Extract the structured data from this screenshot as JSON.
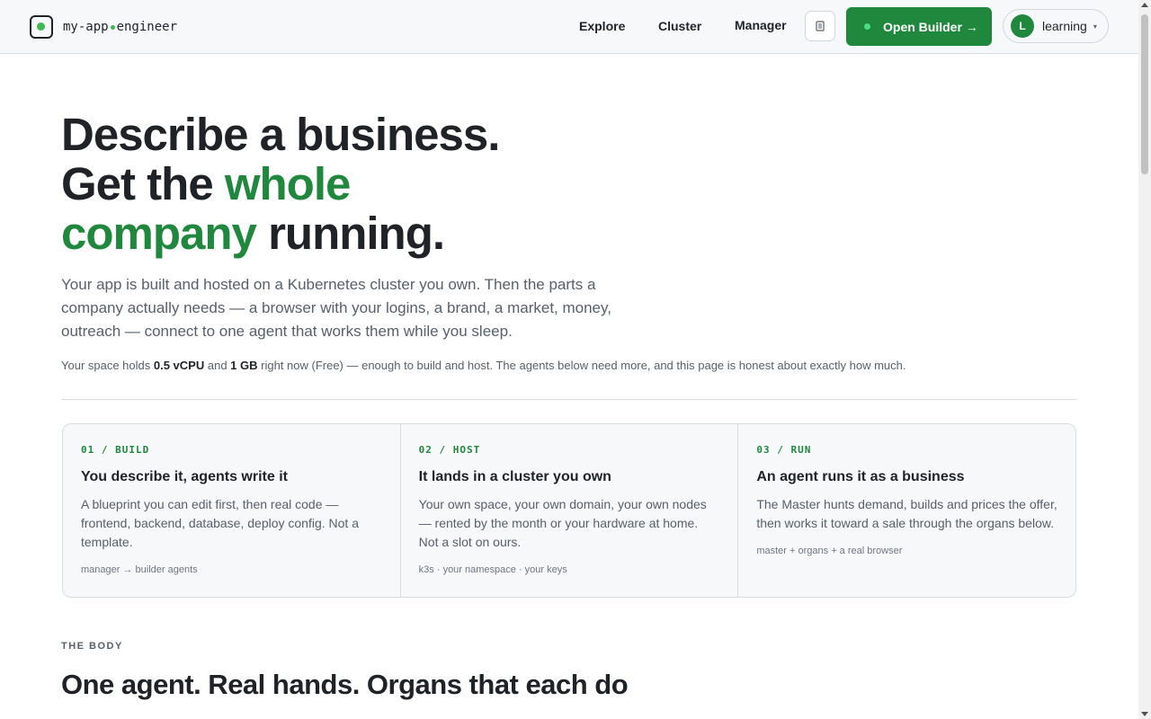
{
  "header": {
    "logo_left": "my-app",
    "logo_right": "engineer",
    "nav": [
      "Explore",
      "Cluster",
      "Manager"
    ],
    "icon_button": "doc-icon",
    "open_builder": "Open Builder →",
    "user": {
      "initial": "L",
      "name": "learning",
      "caret": "▾"
    }
  },
  "hero": {
    "line1": "Describe a business.",
    "line2_pre": "Get the ",
    "line2_green": "whole",
    "line3_green": "company",
    "line3_post": " running."
  },
  "lede": "Your app is built and hosted on a Kubernetes cluster you own. Then the parts a company actually needs — a browser with your logins, a brand, a market, money, outreach — connect to one agent that works them while you sleep.",
  "note": {
    "pre": "Your space holds ",
    "cpu": "0.5 vCPU",
    "mid": " and ",
    "mem": "1 GB",
    "post": " right now (Free) — enough to build and host. The agents below need more, and this page is honest about exactly how much."
  },
  "cards": [
    {
      "step": "01 / BUILD",
      "title": "You describe it, agents write it",
      "desc": "A blueprint you can edit first, then real code — frontend, backend, database, deploy config. Not a template.",
      "foot": "manager → builder agents"
    },
    {
      "step": "02 / HOST",
      "title": "It lands in a cluster you own",
      "desc": "Your own space, your own domain, your own nodes — rented by the month or your hardware at home. Not a slot on ours.",
      "foot": "k3s · your namespace · your keys"
    },
    {
      "step": "03 / RUN",
      "title": "An agent runs it as a business",
      "desc": "The Master hunts demand, builds and prices the offer, then works it toward a sale through the organs below.",
      "foot": "master + organs + a real browser"
    }
  ],
  "section": {
    "label": "THE BODY",
    "title": "One agent. Real hands. Organs that each do"
  },
  "colors": {
    "accent": "#1f883d",
    "accent_dot": "#3fb950"
  }
}
